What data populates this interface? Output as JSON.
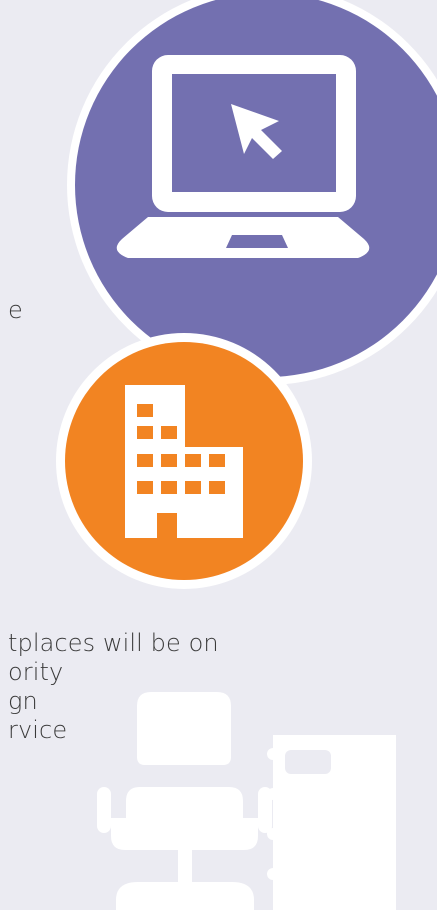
{
  "colors": {
    "background": "#EBEBF2",
    "purple_circle": "#7370B0",
    "orange_circle": "#F28422",
    "icon_white": "#FFFFFF"
  },
  "icons": {
    "laptop": "laptop-cursor-icon",
    "building": "building-icon",
    "chair": "office-chair-icon",
    "cabinet": "filing-cabinet-icon"
  },
  "text": {
    "fragment_top": "e",
    "lines": [
      "tplaces will be on",
      "ority",
      "gn",
      "rvice"
    ]
  }
}
